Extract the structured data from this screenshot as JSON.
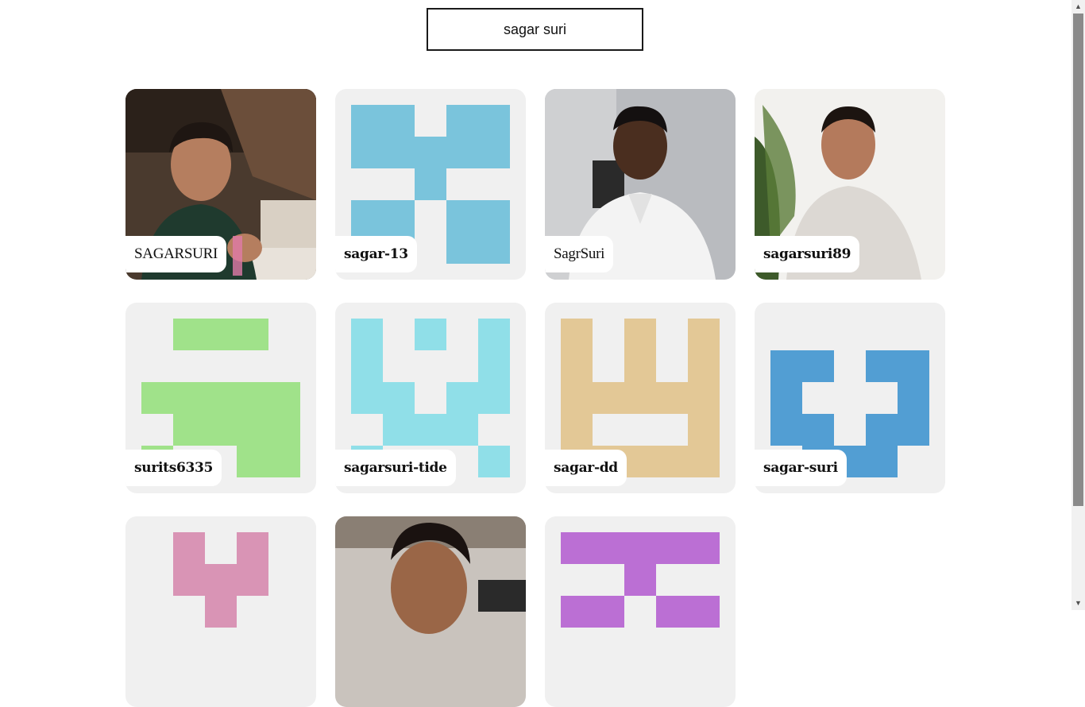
{
  "search": {
    "value": "sagar suri",
    "placeholder": ""
  },
  "users": [
    {
      "username": "SAGARSURI",
      "avatar_type": "photo",
      "avatar_desc": "photo-avatar"
    },
    {
      "username": "sagar-13",
      "avatar_type": "identicon",
      "color": "#7ac4dc"
    },
    {
      "username": "SagrSuri",
      "avatar_type": "photo",
      "avatar_desc": "photo-avatar"
    },
    {
      "username": "sagarsuri89",
      "avatar_type": "photo",
      "avatar_desc": "photo-avatar"
    },
    {
      "username": "surits6335",
      "avatar_type": "identicon",
      "color": "#a0e28a"
    },
    {
      "username": "sagarsuri-tide",
      "avatar_type": "identicon",
      "color": "#90dfe8"
    },
    {
      "username": "sagar-dd",
      "avatar_type": "identicon",
      "color": "#e3c896"
    },
    {
      "username": "sagar-suri",
      "avatar_type": "identicon",
      "color": "#529ed3"
    },
    {
      "username": "",
      "avatar_type": "identicon",
      "color": "#d994b5"
    },
    {
      "username": "",
      "avatar_type": "photo",
      "avatar_desc": "photo-avatar"
    },
    {
      "username": "",
      "avatar_type": "identicon",
      "color": "#bb6fd4"
    }
  ],
  "colors": {
    "card_bg": "#f0f0f0",
    "label_bg": "#ffffff",
    "search_border": "#1a1a1a"
  }
}
